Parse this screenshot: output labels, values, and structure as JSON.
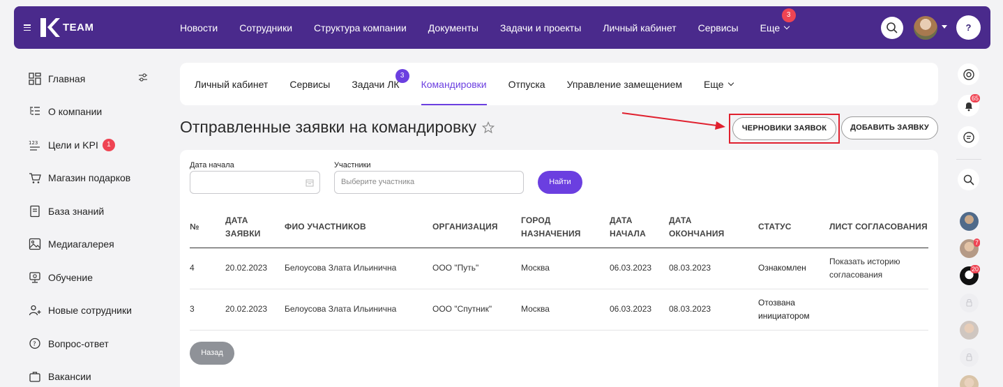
{
  "topbar": {
    "logo_text": "TEAM",
    "nav": [
      "Новости",
      "Сотрудники",
      "Структура компании",
      "Документы",
      "Задачи и проекты",
      "Личный кабинет",
      "Сервисы"
    ],
    "more_label": "Еще",
    "more_badge": "3",
    "help_label": "?"
  },
  "sidebar": {
    "items": [
      {
        "label": "Главная",
        "icon": "dashboard-icon"
      },
      {
        "label": "О компании",
        "icon": "company-icon"
      },
      {
        "label": "Цели и KPI",
        "icon": "kpi-icon",
        "badge": "1"
      },
      {
        "label": "Магазин подарков",
        "icon": "cart-icon"
      },
      {
        "label": "База знаний",
        "icon": "book-icon"
      },
      {
        "label": "Медиагалерея",
        "icon": "gallery-icon"
      },
      {
        "label": "Обучение",
        "icon": "education-icon"
      },
      {
        "label": "Новые сотрудники",
        "icon": "add-user-icon"
      },
      {
        "label": "Вопрос-ответ",
        "icon": "faq-icon"
      },
      {
        "label": "Вакансии",
        "icon": "vacancy-icon"
      }
    ]
  },
  "tabs": {
    "items": [
      "Личный кабинет",
      "Сервисы",
      "Задачи ЛК",
      "Командировки",
      "Отпуска",
      "Управление замещением"
    ],
    "tasks_badge": "3",
    "more_label": "Еще"
  },
  "page": {
    "title": "Отправленные заявки на командировку",
    "drafts_button": "ЧЕРНОВИКИ ЗАЯВОК",
    "add_button": "ДОБАВИТЬ ЗАЯВКУ"
  },
  "filters": {
    "start_date_label": "Дата начала",
    "start_date_value": "",
    "participants_label": "Участники",
    "participants_placeholder": "Выберите участника",
    "find_button": "Найти"
  },
  "table": {
    "headers": {
      "num": "№",
      "req_date_1": "ДАТА",
      "req_date_2": "ЗАЯВКИ",
      "participants": "ФИО УЧАСТНИКОВ",
      "org": "ОРГАНИЗАЦИЯ",
      "city_1": "ГОРОД",
      "city_2": "НАЗНАЧЕНИЯ",
      "start_1": "ДАТА",
      "start_2": "НАЧАЛА",
      "end_1": "ДАТА",
      "end_2": "ОКОНЧАНИЯ",
      "status": "СТАТУС",
      "approval": "ЛИСТ СОГЛАСОВАНИЯ"
    },
    "rows": [
      {
        "num": "4",
        "req_date": "20.02.2023",
        "participants": "Белоусова Злата Ильинична",
        "org": "ООО \"Путь\"",
        "city": "Москва",
        "start": "06.03.2023",
        "end": "08.03.2023",
        "status_1": "Ознакомлен",
        "status_2": "",
        "approval_1": "Показать историю",
        "approval_2": "согласования"
      },
      {
        "num": "3",
        "req_date": "20.02.2023",
        "participants": "Белоусова Злата Ильинична",
        "org": "ООО \"Спутник\"",
        "city": "Москва",
        "start": "06.03.2023",
        "end": "08.03.2023",
        "status_1": "Отозвана",
        "status_2": "инициатором",
        "approval_1": "",
        "approval_2": ""
      }
    ],
    "back_button": "Назад"
  },
  "right_rail": {
    "notifications_badge": "65",
    "avatar_badges": [
      "7",
      "20"
    ]
  },
  "colors": {
    "topbar": "#4a2a8c",
    "accent": "#6b3fe0",
    "badge": "#ef4453",
    "highlight": "#e0202e"
  }
}
